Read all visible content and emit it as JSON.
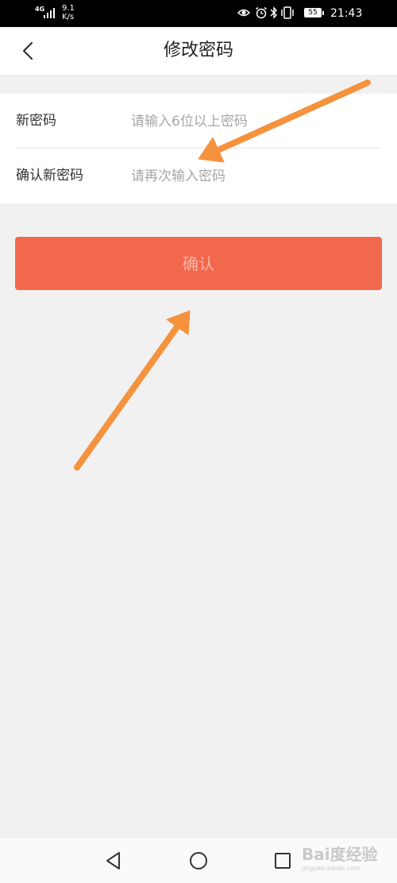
{
  "status_bar": {
    "network": "4G",
    "speed_value": "9.1",
    "speed_unit": "K/s",
    "battery": "55",
    "time": "21:43"
  },
  "header": {
    "title": "修改密码",
    "back_icon": "chevron-left-icon"
  },
  "form": {
    "new_password": {
      "label": "新密码",
      "placeholder": "请输入6位以上密码",
      "value": ""
    },
    "confirm_password": {
      "label": "确认新密码",
      "placeholder": "请再次输入密码",
      "value": ""
    }
  },
  "confirm_button": {
    "label": "确认",
    "color": "#f2684d",
    "text_color": "#f6b5a6"
  },
  "annotations": {
    "arrow_color": "#f5923e"
  },
  "system_nav": {
    "back_icon": "triangle-back-icon",
    "home_icon": "circle-home-icon",
    "recent_icon": "square-recent-icon"
  },
  "watermark": {
    "text": "Bai度经验",
    "subtext": "jingyan.baidu.com"
  }
}
